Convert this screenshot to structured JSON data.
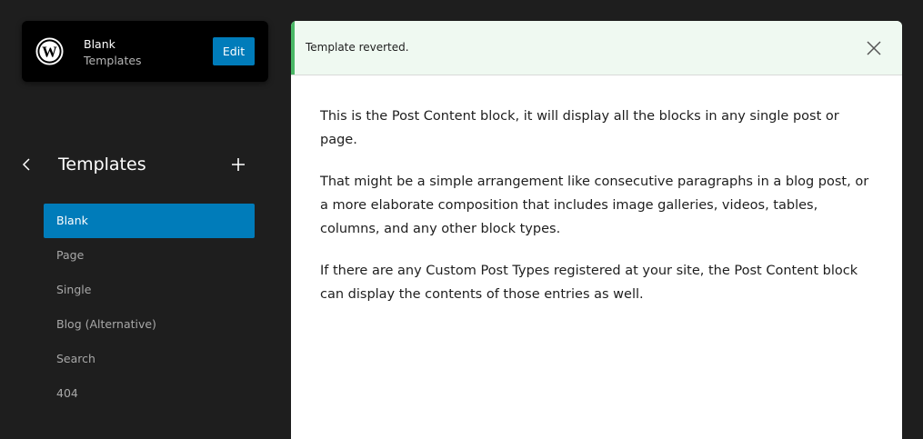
{
  "site": {
    "title": "Blank",
    "subtitle": "Templates",
    "edit_label": "Edit"
  },
  "nav": {
    "title": "Templates",
    "items": [
      {
        "label": "Blank",
        "active": true
      },
      {
        "label": "Page"
      },
      {
        "label": "Single"
      },
      {
        "label": "Blog (Alternative)"
      },
      {
        "label": "Search"
      },
      {
        "label": "404"
      }
    ]
  },
  "notice": {
    "message": "Template reverted."
  },
  "content": {
    "paragraphs": [
      "This is the Post Content block, it will display all the blocks in any single post or page.",
      "That might be a simple arrangement like consecutive paragraphs in a blog post, or a more elaborate composition that includes image galleries, videos, tables, columns, and any other block types.",
      "If there are any Custom Post Types registered at your site, the Post Content block can display the contents of those entries as well."
    ]
  },
  "icons": {
    "logo": "wordpress-icon",
    "back": "chevron-left-icon",
    "add": "plus-icon",
    "close": "close-icon"
  },
  "colors": {
    "accent": "#007cba",
    "success": "#4ab866",
    "sidebar_bg": "#1e1e1e"
  }
}
